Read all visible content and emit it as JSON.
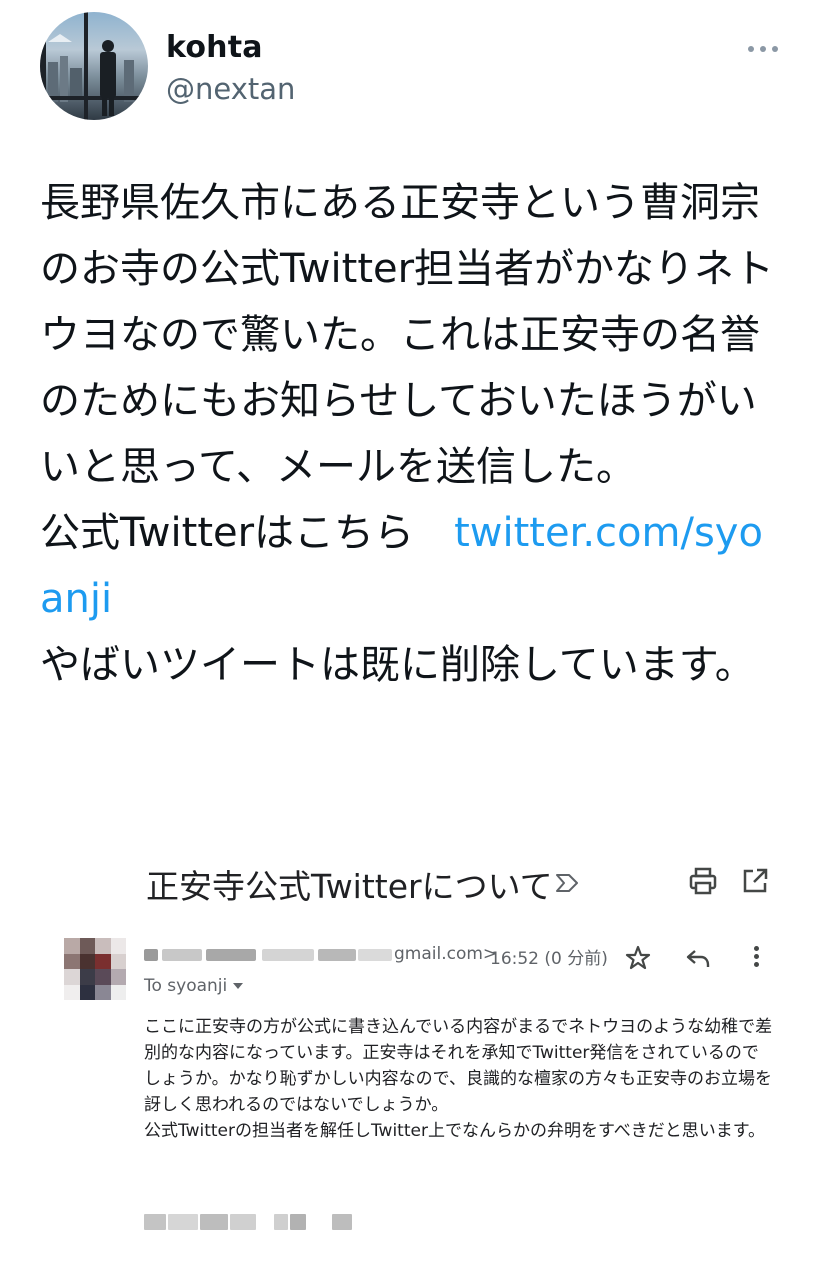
{
  "tweet": {
    "author_name": "kohta",
    "author_handle": "@nextan",
    "text_before_link": "長野県佐久市にある正安寺という曹洞宗のお寺の公式Twitter担当者がかなりネトウヨなので驚いた。これは正安寺の名誉のためにもお知らせしておいたほうがいいと思って、メールを送信した。\n公式Twitterはこちら　",
    "link_text": "twitter.com/syoanji",
    "text_after_link": "\nやばいツイートは既に削除しています。"
  },
  "email": {
    "subject": "正安寺公式Twitterについて",
    "sender_domain": "gmail.com>",
    "time": "16:52 (0 分前)",
    "recipients": "To syoanji",
    "body": "ここに正安寺の方が公式に書き込んでいる内容がまるでネトウヨのような幼稚で差別的な内容になっています。正安寺はそれを承知でTwitter発信をされているのでしょうか。かなり恥ずかしい内容なので、良識的な檀家の方々も正安寺のお立場を訝しく思われるのではないでしょうか。\n公式Twitterの担当者を解任しTwitter上でなんらかの弁明をすべきだと思います。"
  },
  "colors": {
    "link": "#1d9bf0",
    "handle": "#536471",
    "email_meta": "#5f6368"
  },
  "icons": [
    "more-horizontal-icon",
    "label-icon",
    "print-icon",
    "open-in-new-icon",
    "star-icon",
    "reply-icon",
    "more-vertical-icon",
    "caret-down-icon"
  ]
}
